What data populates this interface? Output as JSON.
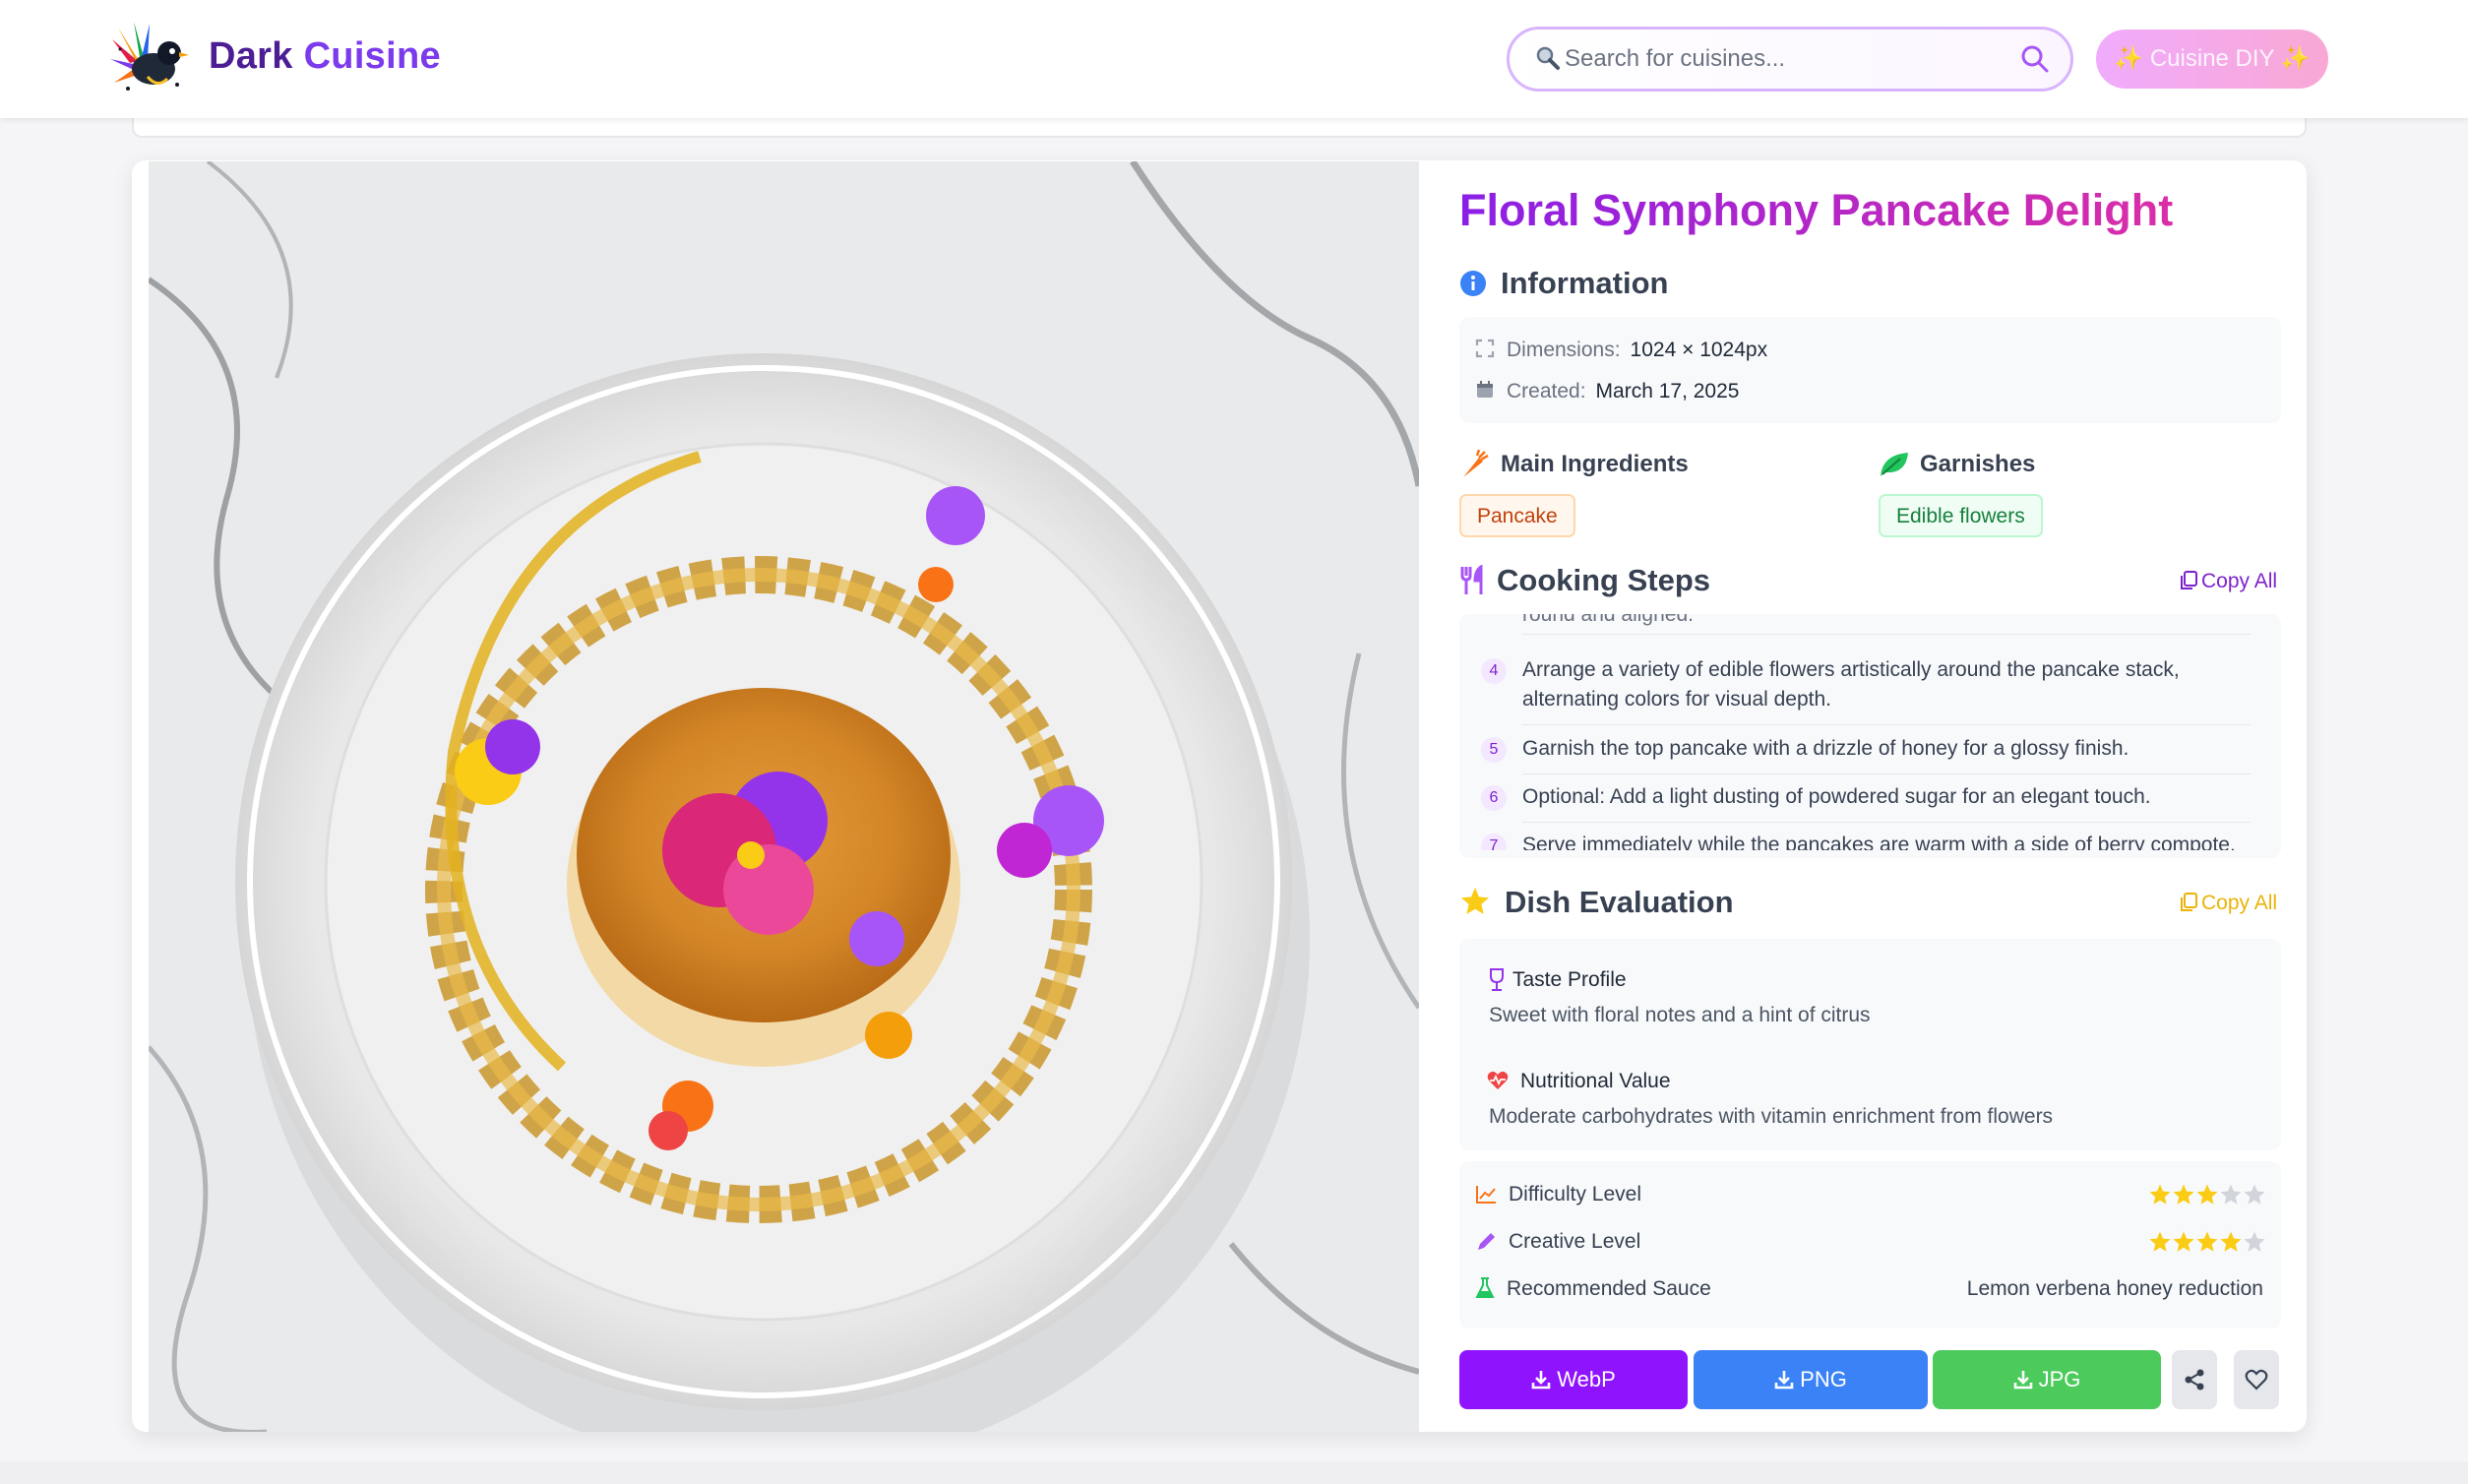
{
  "header": {
    "brand_part1": "Dark",
    "brand_part2": "Cuisine",
    "search_placeholder": "Search for cuisines...",
    "diy_button": "✨ Cuisine DIY ✨"
  },
  "dish": {
    "title": "Floral Symphony Pancake Delight",
    "information_heading": "Information",
    "dimensions_label": "Dimensions:",
    "dimensions_value": "1024 × 1024px",
    "created_label": "Created:",
    "created_value": "March 17, 2025",
    "main_ingredients_heading": "Main Ingredients",
    "main_ingredients": [
      "Pancake"
    ],
    "garnishes_heading": "Garnishes",
    "garnishes": [
      "Edible flowers"
    ],
    "cooking_steps_heading": "Cooking Steps",
    "copy_all": "Copy All",
    "steps_partial_top": "round and aligned.",
    "steps": [
      {
        "num": "4",
        "text": "Arrange a variety of edible flowers artistically around the pancake stack, alternating colors for visual depth."
      },
      {
        "num": "5",
        "text": "Garnish the top pancake with a drizzle of honey for a glossy finish."
      },
      {
        "num": "6",
        "text": "Optional: Add a light dusting of powdered sugar for an elegant touch."
      },
      {
        "num": "7",
        "text": "Serve immediately while the pancakes are warm with a side of berry compote."
      }
    ],
    "evaluation_heading": "Dish Evaluation",
    "taste_label": "Taste Profile",
    "taste_value": "Sweet with floral notes and a hint of citrus",
    "nutrition_label": "Nutritional Value",
    "nutrition_value": "Moderate carbohydrates with vitamin enrichment from flowers",
    "difficulty_label": "Difficulty Level",
    "difficulty_rating": 3,
    "creative_label": "Creative Level",
    "creative_rating": 4,
    "rating_max": 5,
    "sauce_label": "Recommended Sauce",
    "sauce_value": "Lemon verbena honey reduction"
  },
  "downloads": {
    "webp": "WebP",
    "png": "PNG",
    "jpg": "JPG"
  },
  "colors": {
    "brand_dark": "#4c1d95",
    "brand_accent": "#7c3aed",
    "title_gradient_start": "#8b1fe6",
    "title_gradient_end": "#db2ea8",
    "webp_button": "#9013fe",
    "png_button": "#3b82f6",
    "jpg_button": "#4ccb5c",
    "star_filled": "#facc15",
    "star_empty": "#d1d5db"
  },
  "icons": {
    "search_emoji": "magnifier-emoji-icon",
    "search_button": "search-icon",
    "info": "info-icon",
    "dimensions": "expand-icon",
    "created": "calendar-icon",
    "ingredients": "carrot-icon",
    "garnishes": "leaf-icon",
    "steps": "utensils-icon",
    "copy": "copy-icon",
    "evaluation": "star-icon",
    "taste": "wine-glass-icon",
    "nutrition": "heartbeat-icon",
    "difficulty": "chart-line-icon",
    "creative": "pencil-icon",
    "sauce": "flask-icon",
    "download": "download-icon",
    "share": "share-icon",
    "favorite": "heart-icon"
  }
}
